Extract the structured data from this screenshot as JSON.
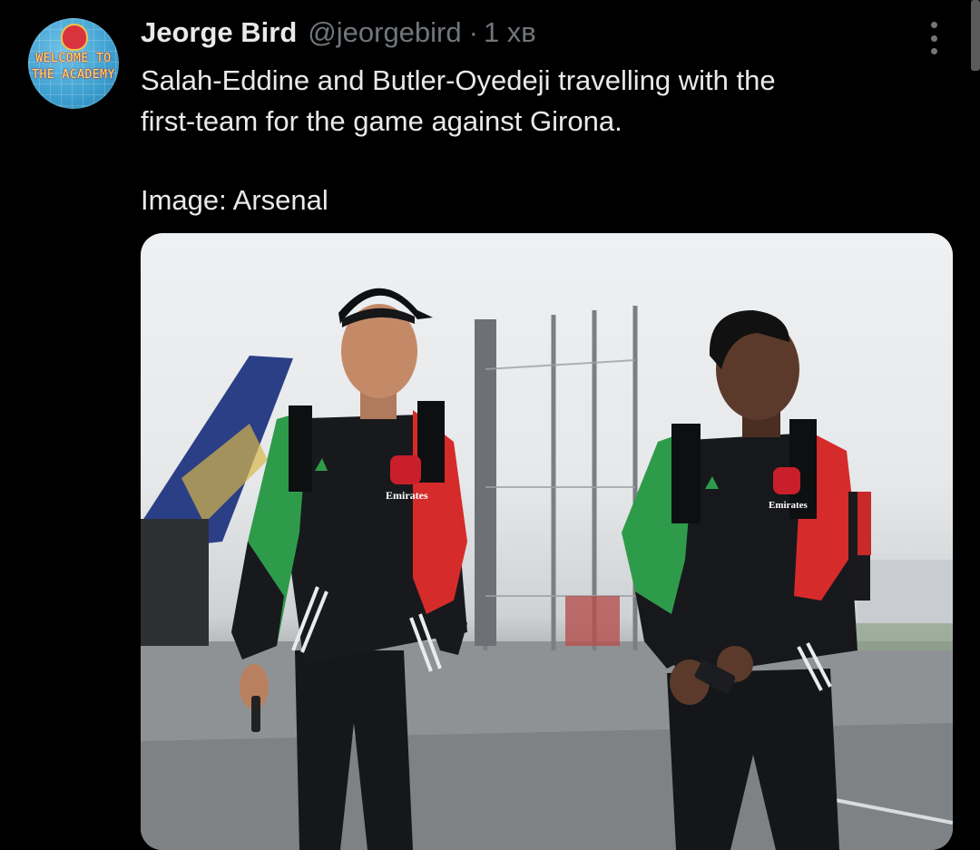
{
  "avatar": {
    "line1": "WELCOME TO",
    "line2": "THE ACADEMY"
  },
  "tweet": {
    "display_name": "Jeorge Bird",
    "handle": "@jeorgebird",
    "separator": "·",
    "timestamp": "1 хв",
    "text_line1": "Salah-Eddine and Butler-Oyedeji travelling with the",
    "text_line2": "first-team for the game against Girona.",
    "text_line3": "Image: Arsenal"
  },
  "media": {
    "sponsor_left": "Emirates",
    "sponsor_right": "Emirates"
  },
  "colors": {
    "background": "#000000",
    "text_primary": "#e7e9ea",
    "text_secondary": "#71767b",
    "jacket_black": "#16181c",
    "jacket_green": "#2e9b4a",
    "jacket_red": "#d62b2b"
  }
}
